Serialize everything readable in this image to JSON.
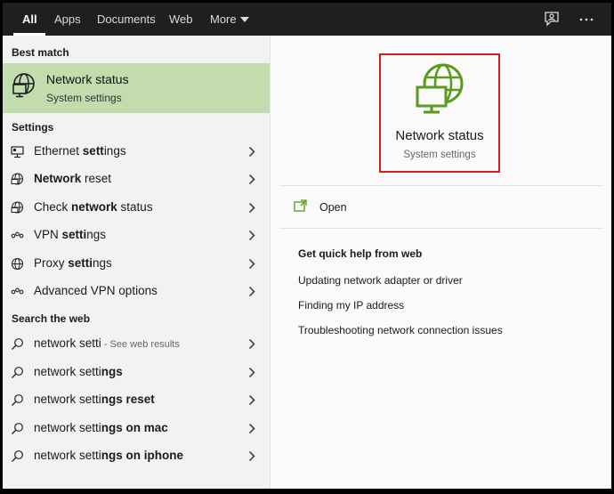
{
  "tabs": [
    {
      "label": "All",
      "active": true
    },
    {
      "label": "Apps"
    },
    {
      "label": "Documents"
    },
    {
      "label": "Web"
    },
    {
      "label": "More"
    }
  ],
  "topbar_icons": [
    "feedback-icon",
    "more-options-icon"
  ],
  "left": {
    "best_match_heading": "Best match",
    "best_match": {
      "title": "Network status",
      "subtitle": "System settings",
      "icon": "network-globe-icon"
    },
    "settings_heading": "Settings",
    "settings": [
      {
        "pre": "Ethernet ",
        "bold": "sett",
        "post": "ings",
        "icon": "ethernet-icon"
      },
      {
        "pre": "",
        "bold": "Network",
        "post": " reset",
        "icon": "network-globe-icon"
      },
      {
        "pre": "Check ",
        "bold": "network",
        "post": " status",
        "icon": "network-globe-icon"
      },
      {
        "pre": "VPN ",
        "bold": "setti",
        "post": "ngs",
        "icon": "vpn-icon"
      },
      {
        "pre": "Proxy ",
        "bold": "setti",
        "post": "ngs",
        "icon": "globe-icon"
      },
      {
        "pre": "Advanced VPN options",
        "bold": "",
        "post": "",
        "icon": "vpn-icon"
      }
    ],
    "web_heading": "Search the web",
    "web": [
      {
        "pre": "network setti",
        "bold": "",
        "post": "",
        "hint": " - See web results"
      },
      {
        "pre": "network setti",
        "bold": "ngs",
        "post": "",
        "hint": ""
      },
      {
        "pre": "network setti",
        "bold": "ngs reset",
        "post": "",
        "hint": ""
      },
      {
        "pre": "network setti",
        "bold": "ngs on mac",
        "post": "",
        "hint": ""
      },
      {
        "pre": "network setti",
        "bold": "ngs on iphone",
        "post": "",
        "hint": ""
      }
    ]
  },
  "right": {
    "title": "Network status",
    "subtitle": "System settings",
    "open_label": "Open",
    "quick_help_title": "Get quick help from web",
    "quick_help_links": [
      "Updating network adapter or driver",
      "Finding my IP address",
      "Troubleshooting network connection issues"
    ]
  },
  "colors": {
    "accent_green": "#5a9a1e",
    "selection_bg": "#c3dcae",
    "highlight_border": "#d62020",
    "topbar_bg": "#1f1f1f"
  }
}
